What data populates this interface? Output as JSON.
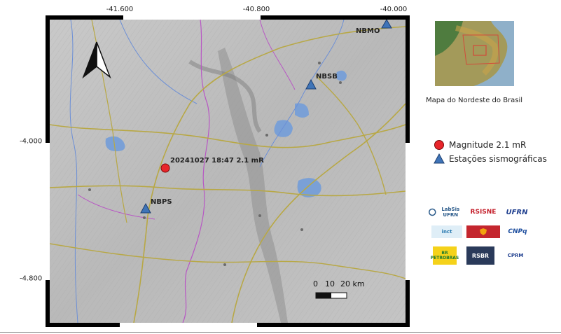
{
  "map": {
    "longitude_ticks": [
      "-41.600",
      "-40.800",
      "-40.000"
    ],
    "latitude_ticks": [
      "-4.000",
      "-4.800"
    ],
    "north_arrow": "north-arrow-icon",
    "event_label": "20241027 18:47 2.1 mR",
    "stations": [
      {
        "code": "NBMO"
      },
      {
        "code": "NBSB"
      },
      {
        "code": "NBPS"
      }
    ],
    "scale_bar": {
      "labels": [
        "0",
        "10",
        "20 km"
      ]
    }
  },
  "inset": {
    "caption": "Mapa do  Nordeste do Brasil"
  },
  "legend": {
    "items": [
      {
        "label": "Magnitude 2.1 mR",
        "symbol": "red-circle",
        "color": "#e8252a"
      },
      {
        "label": "Estações sismográficas",
        "symbol": "blue-triangle",
        "color": "#3f74b8"
      }
    ]
  },
  "logos": {
    "labsis": "LabSis UFRN",
    "rsisne": "RSISNE",
    "ufrn": "UFRN",
    "inct": "inct",
    "cnpq": "CNPq",
    "petrobras": "BR PETROBRAS",
    "rsbr": "RSBR",
    "cprm": "CPRM"
  },
  "colors": {
    "event": "#e8252a",
    "station": "#3f74b8",
    "frame": "#000000",
    "road": "#b8a845",
    "boundary": "#b857c4",
    "river": "#6c8fd6",
    "water": "#7aa0d6"
  }
}
